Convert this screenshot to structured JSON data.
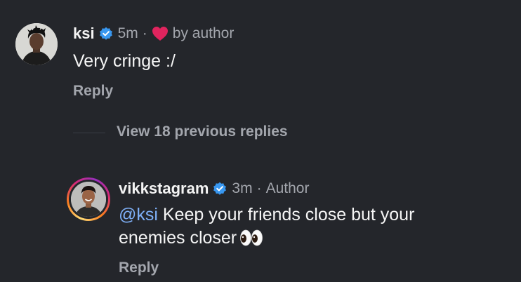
{
  "comments": [
    {
      "username": "ksi",
      "time": "5m",
      "liked_by": "by author",
      "text": "Very cringe :/",
      "reply_label": "Reply"
    },
    {
      "username": "vikkstagram",
      "time": "3m",
      "role": "Author",
      "mention": "@ksi",
      "text_line1": " Keep your friends close but your",
      "text_line2": "enemies closer",
      "emoji": "👀",
      "reply_label": "Reply"
    }
  ],
  "view_replies_label": "View 18 previous replies",
  "separator": "·",
  "icons": {
    "verified": "verified-badge-icon",
    "heart": "heart-icon",
    "eyes": "eyes-emoji-icon"
  },
  "colors": {
    "background": "#24262b",
    "verified_blue": "#3897f0",
    "heart_red": "#e0245e",
    "mention_blue": "#7eaff6",
    "muted_text": "#a3a6ad"
  }
}
